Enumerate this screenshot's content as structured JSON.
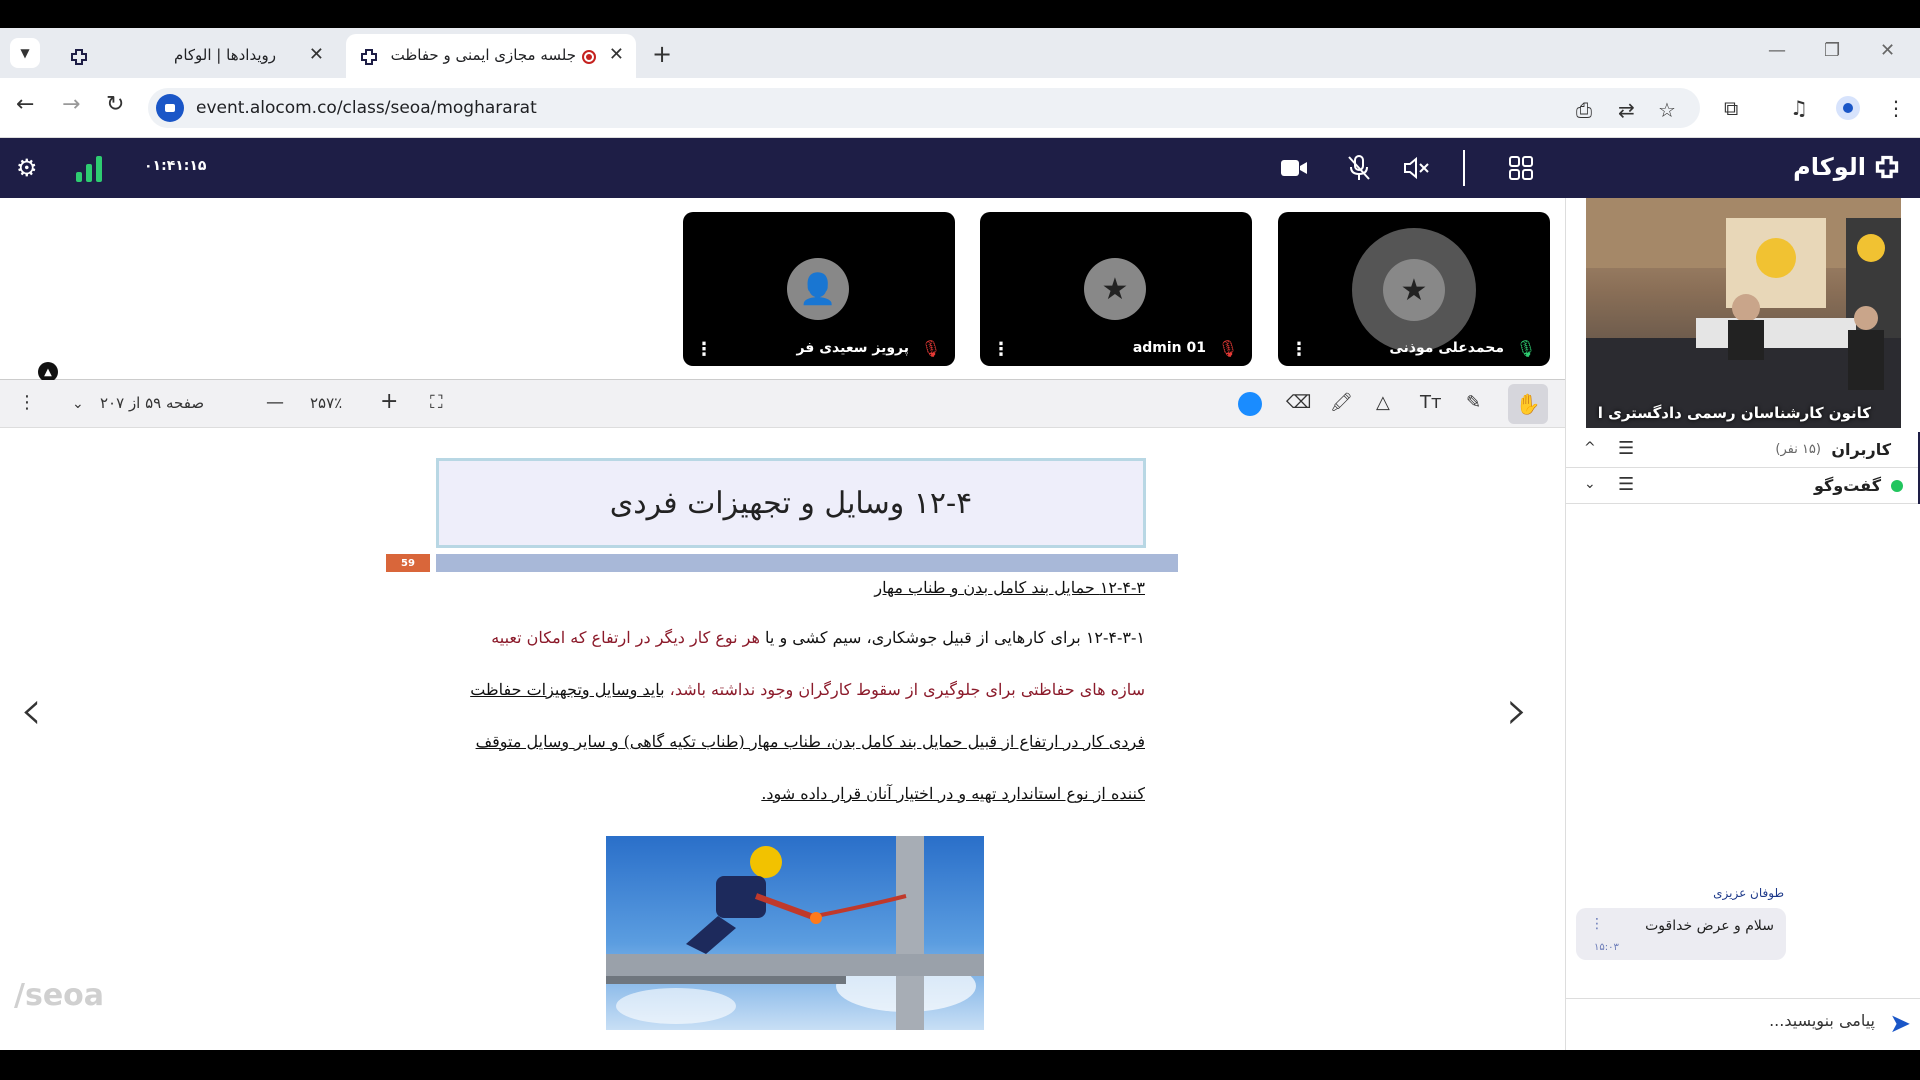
{
  "browser": {
    "tabs": [
      {
        "title": "رویدادها | الوکام",
        "active": false
      },
      {
        "title": "جلسه مجازی ایمنی و حفاظت",
        "active": true
      }
    ],
    "url": "event.alocom.co/class/seoa/moghararаt"
  },
  "app": {
    "logo": "الوکام",
    "timer": "۰۱:۴۱:۱۵",
    "accent": "#1e1e46"
  },
  "participants": [
    {
      "name": "محمدعلی موذنی",
      "mic": "on"
    },
    {
      "name": "admin 01",
      "mic": "off"
    },
    {
      "name": "پرویز سعیدی فر",
      "mic": "off"
    }
  ],
  "toolbar": {
    "page_label": "صفحه ۵۹ از ۲۰۷",
    "zoom": "۲۵۷٪",
    "color": "#1a8cff"
  },
  "document": {
    "title": "۱۲-۴ وسایل و تجهیزات فردی",
    "page_badge": "59",
    "heading": "۱۲-۴-۳ حمایل بند کامل بدن و طناب مهار",
    "para_lines": [
      {
        "a": "۱۲-۴-۳-۱ برای کارهایی از قبیل جوشکاری، سیم کشی و یا ",
        "b": "هر نوع کار دیگر در ارتفاع که امکان تعبیه"
      },
      {
        "a": "سازه های حفاظتی برای جلوگیری از سقوط کارگران وجود نداشته باشد، ",
        "b": "باید وسایل وتجهیزات حفاظت"
      },
      {
        "a": "فردی کار در ارتفاع از قبیل حمایل بند کامل بدن، طناب مهار (طناب تکیه گاهی) و سایر وسایل متوقف",
        "b": ""
      },
      {
        "a": "کننده از نوع استاندارد تهیه و در اختیار آنان قرار داده شود.",
        "b": ""
      }
    ],
    "watermark": "/seoa"
  },
  "sidebar": {
    "camera_label": "کانون کارشناسان رسمی دادگستری ا",
    "users_label": "کاربران",
    "users_count": "(۱۵ نفر)",
    "chat_label": "گفت‌وگو",
    "chat": {
      "sender": "طوفان عزیزی",
      "message": "سلام و عرض خداقوت",
      "time": "۱۵:۰۳"
    },
    "input_placeholder": "پیامی بنویسید..."
  }
}
